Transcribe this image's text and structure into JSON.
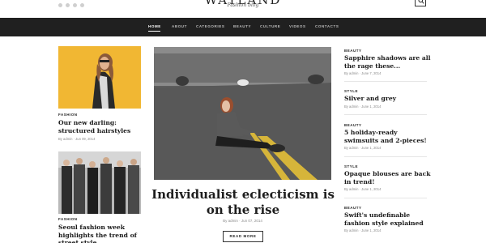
{
  "header": {
    "logo": "WAYLAND",
    "tagline": "Fashion blog"
  },
  "nav": {
    "items": [
      {
        "label": "HOME",
        "active": true
      },
      {
        "label": "ABOUT"
      },
      {
        "label": "CATEGORIES"
      },
      {
        "label": "BEAUTY"
      },
      {
        "label": "CULTURE"
      },
      {
        "label": "VIDEOS"
      },
      {
        "label": "CONTACTS"
      }
    ]
  },
  "left": [
    {
      "category": "FASHION",
      "title": "Our new darling: structured hairstyles",
      "meta": "By admin  ·  Jun 09, 2014"
    },
    {
      "category": "FASHION",
      "title": "Seoul fashion week highlights the trend of street style",
      "meta": ""
    }
  ],
  "hero": {
    "title": "Individualist eclecticism is on the rise",
    "meta": "By admin  ·  Jun 07, 2014",
    "button": "READ MORE"
  },
  "right": [
    {
      "category": "BEAUTY",
      "title": "Sapphire shadows are all the rage these...",
      "meta": "By admin  ·  June 7, 2014"
    },
    {
      "category": "STYLE",
      "title": "Silver and grey",
      "meta": "By admin  ·  June 1, 2014"
    },
    {
      "category": "BEAUTY",
      "title": "5 holiday-ready swimsuits and 2-pieces!",
      "meta": "By admin  ·  June 1, 2014"
    },
    {
      "category": "STYLE",
      "title": "Opaque blouses are back in trend!",
      "meta": "By admin  ·  June 1, 2014"
    },
    {
      "category": "BEAUTY",
      "title": "Swift's undefinable fashion style explained",
      "meta": "By admin  ·  June 1, 2014"
    }
  ],
  "colors": {
    "nav_bg": "#202020",
    "accent_yellow": "#f0b932"
  }
}
